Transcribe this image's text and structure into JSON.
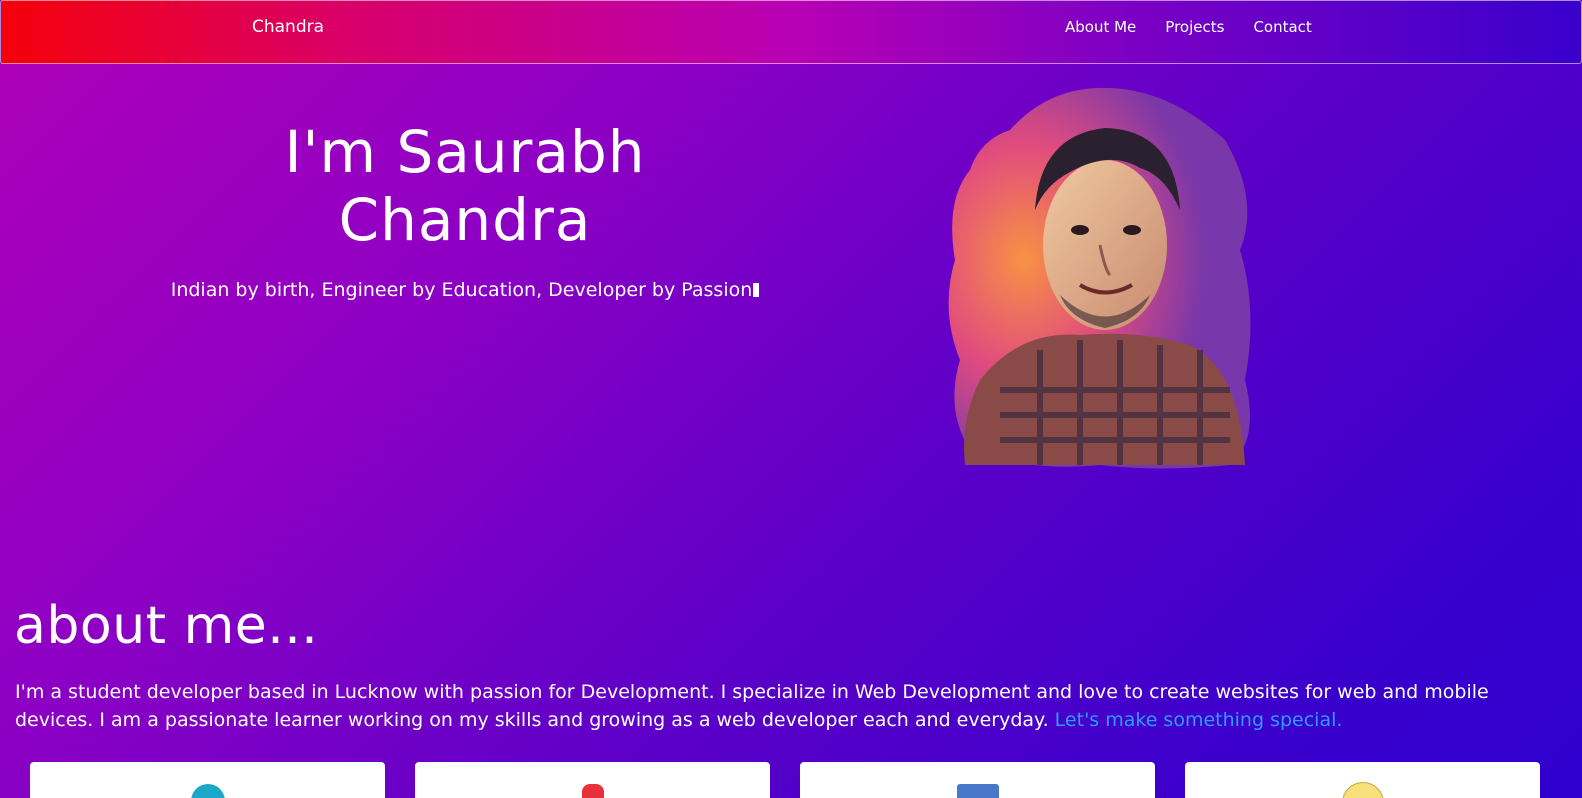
{
  "navbar": {
    "brand": "Chandra",
    "links": [
      "About Me",
      "Projects",
      "Contact"
    ]
  },
  "hero": {
    "title_line1": "I'm Saurabh",
    "title_line2": "Chandra",
    "subtitle": "Indian by birth, Engineer by Education, Developer by Passion"
  },
  "about": {
    "heading": "about me...",
    "text": "I'm a student developer based in Lucknow with passion for Development. I specialize in Web Development and love to create websites for web and mobile devices. I am a passionate learner working on my skills and growing as a web developer each and everyday. ",
    "link": "Let's make something special."
  },
  "cards": [
    {
      "icon": "teal-circle-icon",
      "color": "#1aa8c8"
    },
    {
      "icon": "red-shape-icon",
      "color": "#e8303a"
    },
    {
      "icon": "blue-square-icon",
      "color": "#4a78c8"
    },
    {
      "icon": "yellow-circle-icon",
      "color": "#f5e07a"
    }
  ],
  "colors": {
    "link": "#2d9bff",
    "nav_start": "#f5000a",
    "nav_end": "#3a00cc"
  }
}
